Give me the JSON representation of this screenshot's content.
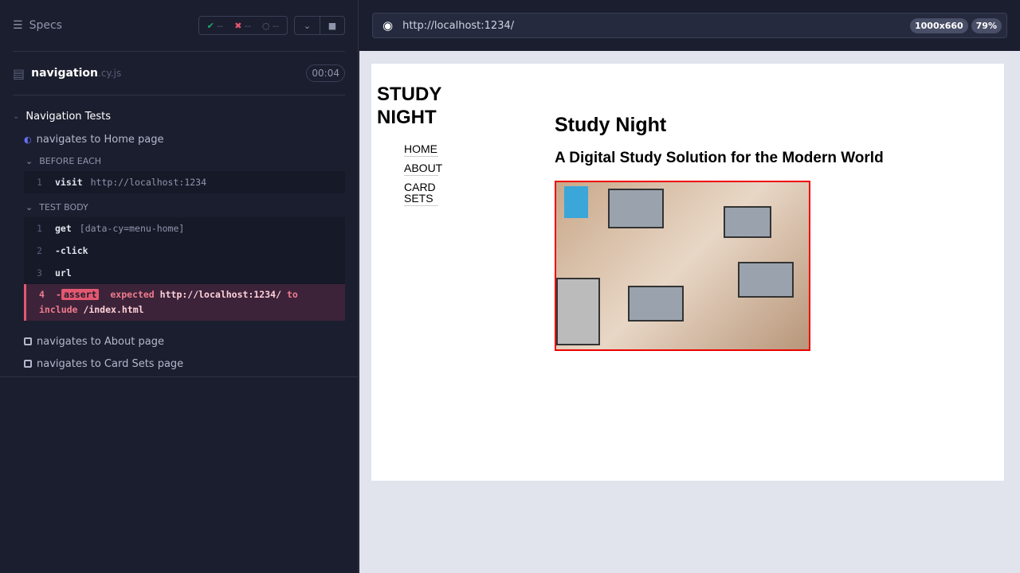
{
  "reporter": {
    "specs_label": "Specs",
    "passed": "--",
    "failed": "--",
    "pending": "--",
    "file_name": "navigation",
    "file_ext": ".cy.js",
    "duration": "00:04",
    "suite": "Navigation Tests",
    "tests": [
      {
        "title": "navigates to Home page",
        "state": "running"
      },
      {
        "title": "navigates to About page",
        "state": "pending"
      },
      {
        "title": "navigates to Card Sets page",
        "state": "pending"
      }
    ],
    "before_each": {
      "label": "BEFORE EACH",
      "commands": [
        {
          "n": "1",
          "name": "visit",
          "arg": "http://localhost:1234"
        }
      ]
    },
    "test_body": {
      "label": "TEST BODY",
      "commands": [
        {
          "n": "1",
          "name": "get",
          "arg": "[data-cy=menu-home]"
        },
        {
          "n": "2",
          "name": "-click",
          "arg": ""
        },
        {
          "n": "3",
          "name": "url",
          "arg": ""
        }
      ],
      "failed": {
        "n": "4",
        "dash": "-",
        "name": "assert",
        "t1": "expected",
        "v1": "http://localhost:1234/",
        "t2": "to",
        "t3": "include",
        "v2": "/index.html"
      }
    }
  },
  "browser": {
    "url": "http://localhost:1234/",
    "viewport": "1000x660",
    "zoom": "79%"
  },
  "app": {
    "logo_line1": "STUDY",
    "logo_line2": "NIGHT",
    "nav": [
      "HOME",
      "ABOUT",
      "CARD SETS"
    ],
    "title": "Study Night",
    "subtitle": "A Digital Study Solution for the Modern World"
  },
  "colors": {
    "pass": "#1fa971",
    "fail": "#e45770",
    "bg": "#1b1e2e"
  }
}
